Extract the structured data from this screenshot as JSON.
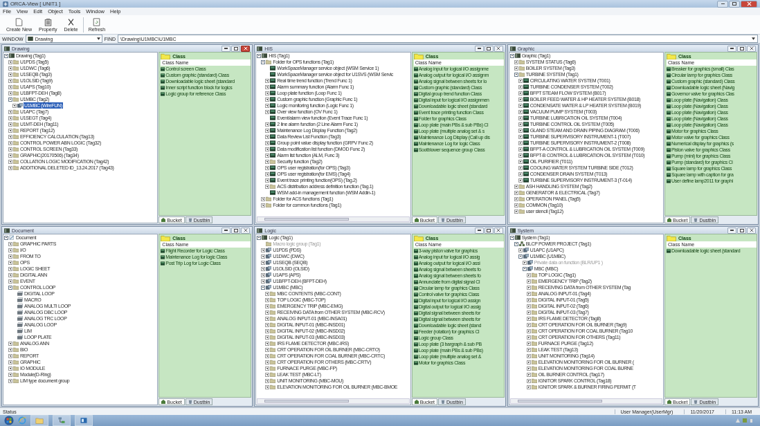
{
  "window": {
    "title": "ORCA-View [ UNIT1 ]"
  },
  "menu": [
    "File",
    "View",
    "Edit",
    "Object",
    "Tools",
    "Window",
    "Help"
  ],
  "toolbar": [
    {
      "label": "Create New",
      "kind": "new"
    },
    {
      "label": "Property",
      "kind": "property"
    },
    {
      "label": "Delete",
      "kind": "delete"
    },
    {
      "label": "Refresh",
      "kind": "refresh"
    }
  ],
  "path_bar": {
    "window_label": "WINDOW",
    "window_value": "Drawing",
    "find_label": "FIND",
    "find_value": "\\Drawing\\U1MBC\\U1MBC"
  },
  "panes": [
    {
      "title": "Drawing",
      "active": true,
      "scrollbars": false,
      "class_heading": "Class",
      "class_column": "Class Name",
      "tabs": [
        {
          "label": "Bucket",
          "selected": true
        },
        {
          "label": "Dustbin",
          "selected": false
        }
      ],
      "tree": {
        "label": "Drawing (Tag1)",
        "kind": "root",
        "expanded": true,
        "children": [
          {
            "label": "U1PDS (Tag5)",
            "kind": "folder",
            "expanded": false
          },
          {
            "label": "U1DWC (Tag6)",
            "kind": "folder",
            "expanded": false
          },
          {
            "label": "U1SEQB (Tag3)",
            "kind": "folder",
            "expanded": false
          },
          {
            "label": "U1OLSID (Tag9)",
            "kind": "folder",
            "expanded": false
          },
          {
            "label": "U1APS (Tag10)",
            "kind": "folder",
            "expanded": false
          },
          {
            "label": "U1BFPT-DEH (Tag8)",
            "kind": "folder",
            "expanded": false
          },
          {
            "label": "U1MBC (Tag2)",
            "kind": "folder",
            "expanded": true,
            "children": [
              {
                "label": "U1MBC (WireFUN)",
                "kind": "station",
                "expanded": false,
                "selected": true
              }
            ]
          },
          {
            "label": "U1APC (Tag7)",
            "kind": "folder",
            "expanded": false
          },
          {
            "label": "U1SEGT (Tag4)",
            "kind": "folder",
            "expanded": false
          },
          {
            "label": "U1MT-DEH (Tag11)",
            "kind": "folder",
            "expanded": false
          },
          {
            "label": "REPORT (Tag12)",
            "kind": "folder",
            "expanded": false
          },
          {
            "label": "EFFICIENCY CALCULATION (Tag13)",
            "kind": "folder",
            "expanded": false
          },
          {
            "label": "CONTROL POWER ABN LOGIC (Tag32)",
            "kind": "folder",
            "expanded": false
          },
          {
            "label": "CONTROL SCREEN (Tag33)",
            "kind": "folder",
            "expanded": false
          },
          {
            "label": "GRAPHIC(20170506) (Tag34)",
            "kind": "folder",
            "expanded": false
          },
          {
            "label": "COLLATION LOGIC MODIFICATION (Tag42)",
            "kind": "folder",
            "expanded": false
          },
          {
            "label": "ADDITIONAL DELETED ID_13.24.2017 (Tag43)",
            "kind": "folder",
            "expanded": false
          }
        ]
      },
      "classes": [
        "Control screen Class",
        "Custom graphic (standard) Class",
        "Downloadable logic sheet (standard",
        "Inner script function block for logics",
        "Logic group for reference Class"
      ]
    },
    {
      "title": "HIS",
      "active": false,
      "scrollbars": true,
      "class_heading": "Class",
      "class_column": "Class Name",
      "tabs": [
        {
          "label": "Bucket",
          "selected": true
        },
        {
          "label": "Dustbin",
          "selected": false
        }
      ],
      "tree": {
        "label": "HIS (Tag1)",
        "kind": "root",
        "expanded": true,
        "children": [
          {
            "label": "Folder for OPS functions (Tag1)",
            "kind": "folder",
            "expanded": true,
            "children": [
              {
                "label": "WorkSpaceManager service object (WSM Service 1)",
                "kind": "screen"
              },
              {
                "label": "WorkSpaceManager service object for U1SVS (WSM Servic",
                "kind": "screen"
              },
              {
                "label": "Real time trend function (Trend Func 1)",
                "kind": "screen",
                "expanded": false
              },
              {
                "label": "Alarm summary function (Alarm Func 1)",
                "kind": "screen",
                "expanded": false
              },
              {
                "label": "Loop plate function (Loop Func 1)",
                "kind": "screen",
                "expanded": false
              },
              {
                "label": "Custom graphic function (Graphic Func 1)",
                "kind": "screen",
                "expanded": false
              },
              {
                "label": "Logic monitoring function (Logic Func 1)",
                "kind": "screen",
                "expanded": false
              },
              {
                "label": "Over view function (OV Func 1)",
                "kind": "screen",
                "expanded": false
              },
              {
                "label": "Event/alarm view function (Event Trace Func 1)",
                "kind": "screen"
              },
              {
                "label": "2 line alarm function (2 Line Alarm Func 1)",
                "kind": "screen",
                "expanded": false
              },
              {
                "label": "Maintenance Log Display Function (Tag2)",
                "kind": "screen",
                "expanded": false
              },
              {
                "label": "Data Review List Function (Tag3)",
                "kind": "screen",
                "expanded": false
              },
              {
                "label": "Group point value display function (GRPV Func 2)",
                "kind": "screen",
                "expanded": false
              },
              {
                "label": "Data modification list function (DMOD Func 2)",
                "kind": "screen",
                "expanded": false
              },
              {
                "label": "Alarm list function (ALM, Func 3)",
                "kind": "screen",
                "expanded": false
              },
              {
                "label": "Security function (Tag2)",
                "kind": "folder",
                "expanded": false
              },
              {
                "label": "OPS user registration(for OPS) (Tag3)",
                "kind": "screen",
                "expanded": false
              },
              {
                "label": "OPS user registration(for EMS) (Tag4)",
                "kind": "screen",
                "expanded": false
              },
              {
                "label": "Event trace printing function(OPS) (Tag.2)",
                "kind": "screen",
                "expanded": false
              },
              {
                "label": "ACS distribution address definition function (Tag.1)",
                "kind": "folder",
                "expanded": false
              },
              {
                "label": "WSM add-in management function (WSM Addin-1)",
                "kind": "screen"
              }
            ]
          },
          {
            "label": "Folder for ACS functions (Tag1)",
            "kind": "folder",
            "expanded": false
          },
          {
            "label": "Folder for common functions (Tag1)",
            "kind": "folder",
            "expanded": false
          }
        ]
      },
      "classes": [
        "Analog input for logical I/O assignme",
        "Analog output for logical I/O assignm",
        "Analog signal between sheets for lo",
        "Custom graphic (standard) Class",
        "Digital group trend function Class",
        "Digital input for logical I/O assignmen",
        "Downloadable logic sheet (standard",
        "Event trace printing function Class",
        "Folder for graphics Class",
        "Loop plate (main PBs & sub PBs) Cl",
        "Loop plate (multiple analog set & s",
        "Maintenance Log Display (Call up dis",
        "Maintenance Log for logic Class",
        "Sootblower sequence group Class"
      ]
    },
    {
      "title": "Graphic",
      "active": false,
      "scrollbars": false,
      "class_heading": "Class",
      "class_column": "Class Name",
      "tabs": [
        {
          "label": "Bucket",
          "selected": true
        },
        {
          "label": "Dustbin",
          "selected": false
        }
      ],
      "tree": {
        "label": "Graphic (Tag1)",
        "kind": "root",
        "expanded": true,
        "children": [
          {
            "label": "SYSTEM STATUS (Tag6)",
            "kind": "folder",
            "expanded": false
          },
          {
            "label": "BOILER SYSTEM (Tag3)",
            "kind": "folder",
            "expanded": false
          },
          {
            "label": "TURBINE SYSTEM (Tag1)",
            "kind": "folder",
            "expanded": true,
            "children": [
              {
                "label": "CIRCULATING WATER SYSTEM (T001)",
                "kind": "screen",
                "expanded": false
              },
              {
                "label": "TURBINE CONDENSER SYSTEM (T002)",
                "kind": "screen",
                "expanded": false
              },
              {
                "label": "BFPT STEAM FLOW SYSTEM (B017)",
                "kind": "screen",
                "expanded": false
              },
              {
                "label": "BOILER FEED WATER & HP HEATER SYSTEM (B018)",
                "kind": "screen",
                "expanded": false
              },
              {
                "label": "CONDENSATE WATER & LP HEATER SYSTEM (B019)",
                "kind": "screen",
                "expanded": false
              },
              {
                "label": "VACUUM PUMP SYSTEM (T003)",
                "kind": "screen",
                "expanded": false
              },
              {
                "label": "TURBINE LUBRICATION OIL SYSTEM (T004)",
                "kind": "screen",
                "expanded": false
              },
              {
                "label": "TURBINE CONTROL OIL SYSTEM (T005)",
                "kind": "screen",
                "expanded": false
              },
              {
                "label": "GLAND STEAM AND DRAIN PIPING DIAGRAM (T006)",
                "kind": "screen",
                "expanded": false
              },
              {
                "label": "TURBINE SUPERVISORY INSTRUMENT-1 (T007)",
                "kind": "screen",
                "expanded": false
              },
              {
                "label": "TURBINE SUPERVISORY INSTRUMENT-2 (T008)",
                "kind": "screen",
                "expanded": false
              },
              {
                "label": "BFPT-A CONTROL & LUBRICATION OIL SYSTEM (T009)",
                "kind": "screen",
                "expanded": false
              },
              {
                "label": "BFPT-B CONTROL & LUBRICATION OIL SYSTEM (T010)",
                "kind": "screen",
                "expanded": false
              },
              {
                "label": "OIL PURIFIER (T011)",
                "kind": "screen",
                "expanded": false
              },
              {
                "label": "COOLING WATER SYSTEM TURBINE SIDE (T012)",
                "kind": "screen",
                "expanded": false
              },
              {
                "label": "CONDENSER DRAIN SYSTEM (T013)",
                "kind": "screen",
                "expanded": false
              },
              {
                "label": "TURBINE SUPERVISORY INSTRUMENT-3 (T-014)",
                "kind": "screen",
                "expanded": false
              }
            ]
          },
          {
            "label": "ASH HANDLING SYSTEM (Tag2)",
            "kind": "folder",
            "expanded": false
          },
          {
            "label": "GENERATOR & ELECTRICAL (Tag7)",
            "kind": "folder",
            "expanded": false
          },
          {
            "label": "OPERATION PANEL (Tag5)",
            "kind": "folder",
            "expanded": false
          },
          {
            "label": "COMMON (Tag10)",
            "kind": "folder",
            "expanded": false
          },
          {
            "label": "user stencil (Tag12)",
            "kind": "folder",
            "expanded": false
          }
        ]
      },
      "classes": [
        "Breaker for graphics (small) Clas",
        "Circular lamp for graphics Class",
        "Custom graphic (standard) Class",
        "Downloadable logic sheet (Navig",
        "Governor valve for graphics Clas",
        "Loop plate (Navigation) Class",
        "Loop plate (Navigation) Class",
        "Loop plate (Navigation) Class",
        "Loop plate (Navigation) Class",
        "Loop plate (Navigation) Class",
        "Motor for graphics Class",
        "Motor valve for graphics Class",
        "Numerical display for graphics (s",
        "Piston valve for graphics Class",
        "Pump (mini) for graphics Class",
        "Pump (standard) for graphics Cl",
        "Square lamp for graphics Class",
        "Square lamp with caption for gra",
        "User define lamp2011 for graphi"
      ]
    },
    {
      "title": "Document",
      "active": false,
      "scrollbars": false,
      "class_heading": "Class",
      "class_column": "Class Name",
      "tabs": [
        {
          "label": "Bucket",
          "selected": true
        },
        {
          "label": "Dustbin",
          "selected": false
        }
      ],
      "tree": {
        "label": "Document",
        "kind": "document",
        "expanded": true,
        "children": [
          {
            "label": "GRAPHIC PARTS",
            "kind": "folder",
            "expanded": false
          },
          {
            "label": "I/O",
            "kind": "folder",
            "expanded": false
          },
          {
            "label": "FROM TO",
            "kind": "folder",
            "expanded": false
          },
          {
            "label": "OPS",
            "kind": "folder",
            "expanded": false
          },
          {
            "label": "LOGIC SHEET",
            "kind": "folder",
            "expanded": false
          },
          {
            "label": "DIGITAL ANN",
            "kind": "folder",
            "expanded": false
          },
          {
            "label": "EVENT",
            "kind": "folder",
            "expanded": false
          },
          {
            "label": "CONTROL LOOP",
            "kind": "folder",
            "expanded": true,
            "children": [
              {
                "label": "DIGITAL LOOP",
                "kind": "doc"
              },
              {
                "label": "MACRO",
                "kind": "doc"
              },
              {
                "label": "ANALOG MULTI LOOP",
                "kind": "doc"
              },
              {
                "label": "ANALOG DBC LOOP",
                "kind": "doc"
              },
              {
                "label": "ANALOG TRC LOOP",
                "kind": "doc"
              },
              {
                "label": "ANALOG LOOP",
                "kind": "doc"
              },
              {
                "label": "LIM",
                "kind": "doc"
              },
              {
                "label": "LOOP PLATE",
                "kind": "doc"
              }
            ]
          },
          {
            "label": "ANALOG ANN",
            "kind": "folder",
            "expanded": false
          },
          {
            "label": "BIO",
            "kind": "folder",
            "expanded": false
          },
          {
            "label": "REPORT",
            "kind": "folder",
            "expanded": false
          },
          {
            "label": "GRAPHIC",
            "kind": "folder",
            "expanded": false
          },
          {
            "label": "IO MODULE",
            "kind": "folder",
            "expanded": false
          },
          {
            "label": "Module(D-Ring)",
            "kind": "folder",
            "expanded": false
          },
          {
            "label": "LIM type document group",
            "kind": "folder",
            "expanded": false
          }
        ]
      },
      "classes": [
        "Flight Recorder for Logic Class",
        "Maintenance Log for logic Class",
        "Post Trip Log for Logic Class"
      ]
    },
    {
      "title": "Logic",
      "active": false,
      "scrollbars": true,
      "class_heading": "Class",
      "class_column": "Class Name",
      "tabs": [
        {
          "label": "Bucket",
          "selected": true
        },
        {
          "label": "Dustbin",
          "selected": false
        }
      ],
      "tree": {
        "label": "Logic (Tag1)",
        "kind": "root",
        "expanded": true,
        "children": [
          {
            "label": "Macro logic group (Tag1)",
            "kind": "folder",
            "dimmed": true
          },
          {
            "label": "U1PDS (PDS)",
            "kind": "station",
            "expanded": false
          },
          {
            "label": "U1DWC (DWC)",
            "kind": "station",
            "expanded": false
          },
          {
            "label": "U1SEQB (SEQB)",
            "kind": "station",
            "expanded": false
          },
          {
            "label": "U1OLSID (OLSID)",
            "kind": "station",
            "expanded": false
          },
          {
            "label": "U1APS (APS)",
            "kind": "station",
            "expanded": false
          },
          {
            "label": "U1BFPT-DEH (BFPT-DEH)",
            "kind": "station",
            "expanded": false
          },
          {
            "label": "U1MBC (MBC)",
            "kind": "station",
            "expanded": true,
            "children": [
              {
                "label": "MBC CONTENTS (MBC-CONT)",
                "kind": "folder",
                "expanded": false
              },
              {
                "label": "TOP LOGIC (MBC-TOP)",
                "kind": "folder",
                "expanded": false
              },
              {
                "label": "EMERGENCY TRIP (MBC-EMG)",
                "kind": "folder",
                "expanded": false
              },
              {
                "label": "RECEIVING DATA from OTHER SYSTEM (MBC-RCV)",
                "kind": "folder",
                "expanded": false
              },
              {
                "label": "ANALOG INPUT-01 (MBC-INSA01)",
                "kind": "folder",
                "expanded": false
              },
              {
                "label": "DIGITAL INPUT-01 (MBC-INSD01)",
                "kind": "folder",
                "expanded": false
              },
              {
                "label": "DIGITAL INPUT-02 (MBC-INSD02)",
                "kind": "folder",
                "expanded": false
              },
              {
                "label": "DIGITAL INPUT-03 (MBC-INSD03)",
                "kind": "folder",
                "expanded": false
              },
              {
                "label": "IRS FLAME DETECTOR (MBC-IRS)",
                "kind": "folder",
                "expanded": false
              },
              {
                "label": "CRT OPERATION FOR OIL BURNER (MBC-CRTO)",
                "kind": "folder",
                "expanded": false
              },
              {
                "label": "CRT OPERATION FOR COAL BURNER (MBC-CRTC)",
                "kind": "folder",
                "expanded": false
              },
              {
                "label": "CRT OPERATION FOR OTHERS (MBC-CRTV)",
                "kind": "folder",
                "expanded": false
              },
              {
                "label": "FURNACE PURGE (MBC-FP)",
                "kind": "folder",
                "expanded": false
              },
              {
                "label": "LEAK TEST (MBC-LT)",
                "kind": "folder",
                "expanded": false
              },
              {
                "label": "UNIT MONITORING (MBC-MOU)",
                "kind": "folder",
                "expanded": false
              },
              {
                "label": "ELEVATION MONITORING FOR OIL BURNER (MBC-BMOE",
                "kind": "folder",
                "expanded": false
              }
            ]
          }
        ]
      },
      "classes": [
        "3-way piston valve for graphics",
        "Analog input for logical I/O assig",
        "Analog output for logical I/O assi",
        "Analog signal between sheets fo",
        "Analog signal between sheets fo",
        "Annunciate from digital signal Cl",
        "Circular lamp for graphics Class",
        "Control valve for graphics Class",
        "Digital input for logical I/O assign",
        "Digital output for logical I/O assig",
        "Digital signal between sheets for",
        "Digital signal between sheets for",
        "Downloadable logic sheet (stand",
        "Feeder (rotation) for graphics Cl",
        "Logic group Class",
        "Loop plate (3 bargraph & sub PB",
        "Loop plate (main PBs & sub PBs)",
        "Loop plate (multiple analog set &",
        "Motor for graphics Class"
      ]
    },
    {
      "title": "System",
      "active": false,
      "scrollbars": true,
      "class_heading": "Class",
      "class_column": "Class Name",
      "tabs": [
        {
          "label": "Bucket",
          "selected": true
        },
        {
          "label": "Dustbin",
          "selected": false
        }
      ],
      "tree": {
        "label": "System (Tag1)",
        "kind": "root",
        "expanded": true,
        "children": [
          {
            "label": "BLCP POWER PROJECT (Tag1)",
            "kind": "project",
            "expanded": true,
            "children": [
              {
                "label": "U1APC (U1APC)",
                "kind": "station",
                "expanded": false
              },
              {
                "label": "U1MBC (U1MBC)",
                "kind": "station",
                "expanded": true,
                "children": [
                  {
                    "label": "Private data on function (BLR/UP1 )",
                    "kind": "station",
                    "expanded": false,
                    "dimmed": true
                  },
                  {
                    "label": "MBC (MBC)",
                    "kind": "station",
                    "expanded": true,
                    "children": [
                      {
                        "label": "TOP LOGIC (Tag1)",
                        "kind": "folder",
                        "expanded": false
                      },
                      {
                        "label": "EMERGENCY TRIP (Tag2)",
                        "kind": "folder",
                        "expanded": false
                      },
                      {
                        "label": "RECEIVING DATA from OTHER SYSTEM (Tag",
                        "kind": "folder",
                        "expanded": false
                      },
                      {
                        "label": "ANALOG INPUT-01 (Tag4)",
                        "kind": "folder",
                        "expanded": false
                      },
                      {
                        "label": "DIGITAL INPUT-01 (Tag5)",
                        "kind": "folder",
                        "expanded": false
                      },
                      {
                        "label": "DIGITAL INPUT-02 (Tag6)",
                        "kind": "folder",
                        "expanded": false
                      },
                      {
                        "label": "DIGITAL INPUT-03 (Tag7)",
                        "kind": "folder",
                        "expanded": false
                      },
                      {
                        "label": "IRS FLAME DETECTOR (Tag8)",
                        "kind": "folder",
                        "expanded": false
                      },
                      {
                        "label": "CRT OPERATION FOR OIL BURNER (Tag9)",
                        "kind": "folder",
                        "expanded": false
                      },
                      {
                        "label": "CRT OPERATION FOR COAL BURNER (Tag10",
                        "kind": "folder",
                        "expanded": false
                      },
                      {
                        "label": "CRT OPERATION FOR OTHERS (Tag11)",
                        "kind": "folder",
                        "expanded": false
                      },
                      {
                        "label": "FURNACE PURGE (Tag12)",
                        "kind": "folder",
                        "expanded": false
                      },
                      {
                        "label": "LEAK TEST (Tag13)",
                        "kind": "folder",
                        "expanded": false
                      },
                      {
                        "label": "UNIT MONITORING (Tag14)",
                        "kind": "folder",
                        "expanded": false
                      },
                      {
                        "label": "ELEVATION MONITORING FOR OIL BURNER (",
                        "kind": "folder",
                        "expanded": false
                      },
                      {
                        "label": "ELEVATION MONITORING FOR COAL BURNE",
                        "kind": "folder",
                        "expanded": false
                      },
                      {
                        "label": "OIL BURNER CONTROL (Tag17)",
                        "kind": "folder",
                        "expanded": false
                      },
                      {
                        "label": "IGNITOR SPARK CONTROL (Tag18)",
                        "kind": "folder",
                        "expanded": false
                      },
                      {
                        "label": "IGNITOR SPARK & BURNER FIRING PERMIT (T",
                        "kind": "folder",
                        "expanded": false
                      }
                    ]
                  }
                ]
              }
            ]
          }
        ]
      },
      "classes": [
        "Downloadable logic sheet (standard"
      ]
    }
  ],
  "status_bar": {
    "label": "Status",
    "user": "User Manager(UserMgr)",
    "date": "11/20/2017",
    "time": "11:13 AM"
  },
  "taskbar": {
    "apps": [
      {
        "kind": "browser"
      },
      {
        "kind": "explorer"
      },
      {
        "kind": "network"
      },
      {
        "kind": "app"
      }
    ]
  }
}
